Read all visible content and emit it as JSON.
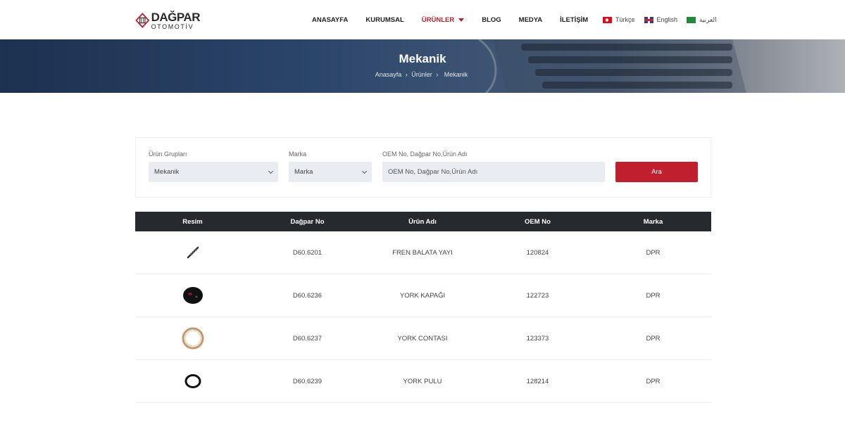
{
  "brand": {
    "name_top": "DAĞPAR",
    "name_bottom": "OTOMOTİV",
    "color": "#c0202e"
  },
  "nav": [
    {
      "label": "ANASAYFA",
      "active": false
    },
    {
      "label": "KURUMSAL",
      "active": false
    },
    {
      "label": "ÜRÜNLER",
      "active": true,
      "has_dropdown": true
    },
    {
      "label": "BLOG",
      "active": false
    },
    {
      "label": "MEDYA",
      "active": false
    },
    {
      "label": "İLETİŞİM",
      "active": false
    }
  ],
  "languages": [
    {
      "label": "Türkçe",
      "flag": "turkey-flag-icon"
    },
    {
      "label": "English",
      "flag": "uk-flag-icon"
    },
    {
      "label": "العربية",
      "flag": "saudi-flag-icon"
    }
  ],
  "banner": {
    "title": "Mekanik",
    "breadcrumb": [
      "Anasayfa",
      "Ürünler",
      "Mekanik"
    ]
  },
  "filter": {
    "group_label": "Ürün Grupları",
    "group_value": "Mekanik",
    "brand_label": "Marka",
    "brand_value": "Marka",
    "search_label": "OEM No, Dağpar No,Ürün Adı",
    "search_placeholder": "OEM No, Dağpar No,Ürün Adı",
    "button_label": "Ara"
  },
  "table": {
    "headers": [
      "Resim",
      "Dağpar No",
      "Ürün Adı",
      "OEM No",
      "Marka"
    ],
    "rows": [
      {
        "image": "spring-part-icon",
        "dagpar_no": "D60.6201",
        "name": "FREN BALATA YAYI",
        "oem_no": "120824",
        "brand": "DPR"
      },
      {
        "image": "cap-part-icon",
        "dagpar_no": "D60.6236",
        "name": "YORK KAPAĞI",
        "oem_no": "122723",
        "brand": "DPR"
      },
      {
        "image": "gasket-part-icon",
        "dagpar_no": "D60.6237",
        "name": "YORK CONTASI",
        "oem_no": "123373",
        "brand": "DPR"
      },
      {
        "image": "washer-part-icon",
        "dagpar_no": "D60.6239",
        "name": "YORK PULU",
        "oem_no": "128214",
        "brand": "DPR"
      }
    ]
  }
}
